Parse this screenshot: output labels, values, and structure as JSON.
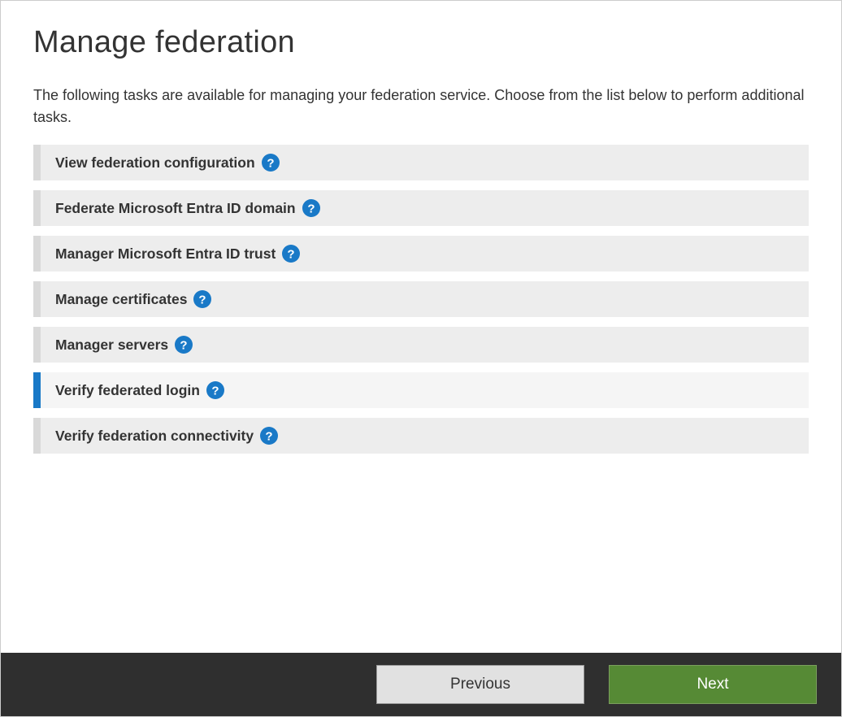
{
  "page": {
    "title": "Manage federation",
    "description": "The following tasks are available for managing your federation service.  Choose from the list below to perform additional tasks."
  },
  "tasks": [
    {
      "label": "View federation configuration",
      "selected": false
    },
    {
      "label": "Federate Microsoft Entra ID domain",
      "selected": false
    },
    {
      "label": "Manager Microsoft Entra ID trust",
      "selected": false
    },
    {
      "label": "Manage certificates",
      "selected": false
    },
    {
      "label": "Manager servers",
      "selected": false
    },
    {
      "label": "Verify federated login",
      "selected": true
    },
    {
      "label": "Verify federation connectivity",
      "selected": false
    }
  ],
  "footer": {
    "previous": "Previous",
    "next": "Next"
  },
  "colors": {
    "accent": "#1979c7",
    "nextButton": "#568a35",
    "footerBg": "#2f2f2f"
  }
}
